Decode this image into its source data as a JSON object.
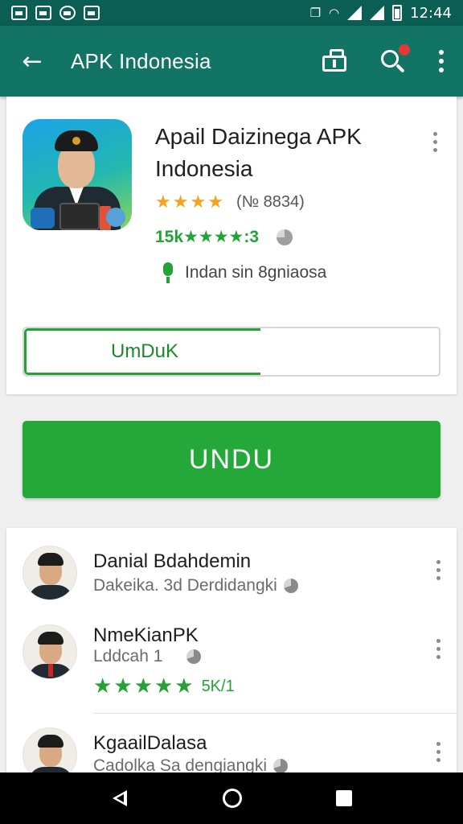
{
  "status_bar": {
    "time": "12:44",
    "left_icons": [
      "photo-icon",
      "chart-icon",
      "messenger-icon",
      "app-icon"
    ],
    "right_icons": [
      "nfc-icon",
      "wifi-icon",
      "signal-icon",
      "signal-icon",
      "battery-icon"
    ]
  },
  "app_bar": {
    "title": "APK Indonesia",
    "back_icon": "arrow-left-icon",
    "actions": [
      "store-icon",
      "search-icon",
      "more-vert-icon"
    ],
    "notification_color": "#e53935"
  },
  "app_card": {
    "name": "Apail Daizinega APK Indonesia",
    "rating_stars": 4,
    "rating_count": "(№ 8834)",
    "downloads": "15k★★★★:3",
    "developer": "Indan sin 8gniaosa",
    "progress_button": {
      "label": "UmDuK",
      "progress": 0.57
    }
  },
  "download_button": {
    "label": "UNDU"
  },
  "list": [
    {
      "title": "Danial Bdahdemin",
      "subtitle": "Dakeika. 3d Derdidangki"
    },
    {
      "title": "NmeKianPK",
      "subtitle": "Lddcah 1",
      "rating_stars": 5,
      "rating_count": "5K/1"
    },
    {
      "title": "KgaailDalasa",
      "subtitle": "Cadolka Sa dengiangki"
    }
  ],
  "colors": {
    "status_bar": "#0b5e53",
    "app_bar": "#127465",
    "accent_green": "#25a83a",
    "star_orange": "#f4a31c",
    "star_green": "#23a335"
  },
  "nav_bar": {
    "buttons": [
      "back-icon",
      "home-icon",
      "recents-icon"
    ]
  }
}
